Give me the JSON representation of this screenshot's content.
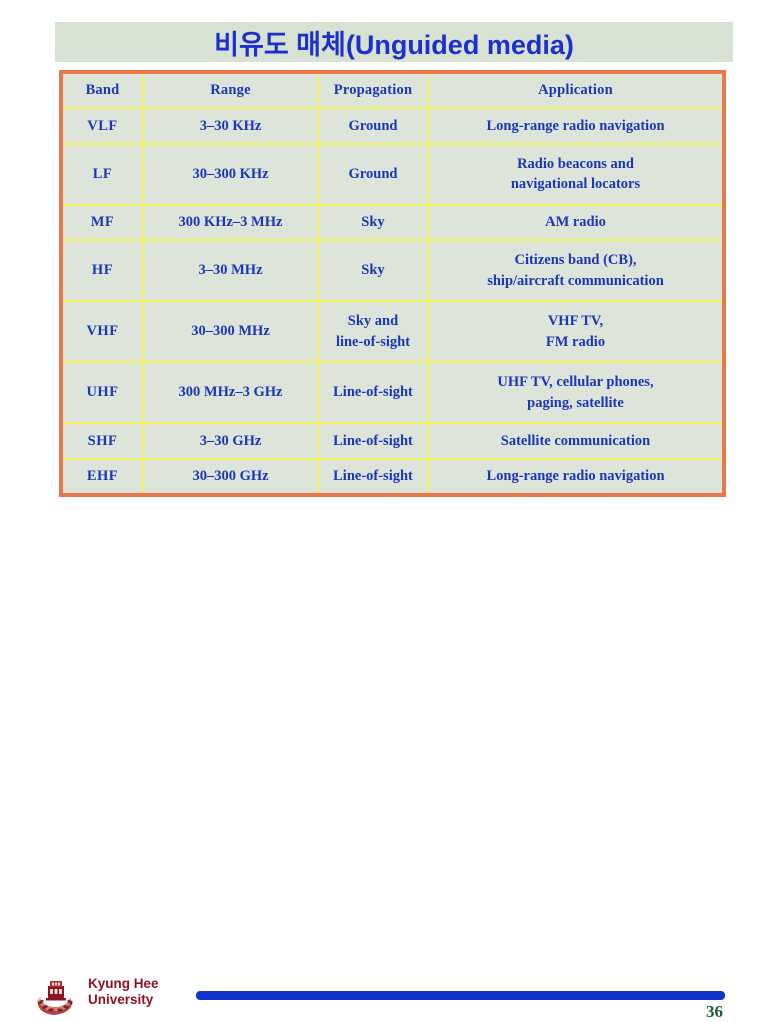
{
  "slide": {
    "title": "비유도 매체(Unguided media)",
    "colors": {
      "title_text": "#1b30cf",
      "title_band_bg": "#d8e2d3",
      "table_border": "#e8784c",
      "grid_line": "#f5f25c",
      "cell_bg": "#dde5da",
      "cell_text": "#1c36b8",
      "band_text": "#e69a7c",
      "footer_bar": "#1134cc",
      "university_text": "#8f1423",
      "page_number_text": "#1f5c33"
    }
  },
  "table": {
    "columns": [
      "Band",
      "Range",
      "Propagation",
      "Application"
    ],
    "rows": [
      {
        "band": "VLF",
        "range": "3–30 KHz",
        "propagation": [
          "Ground"
        ],
        "application": [
          "Long-range radio navigation"
        ]
      },
      {
        "band": "LF",
        "range": "30–300 KHz",
        "propagation": [
          "Ground"
        ],
        "application": [
          "Radio beacons and",
          "navigational locators"
        ]
      },
      {
        "band": "MF",
        "range": "300 KHz–3 MHz",
        "propagation": [
          "Sky"
        ],
        "application": [
          "AM radio"
        ]
      },
      {
        "band": "HF",
        "range": "3–30 MHz",
        "propagation": [
          "Sky"
        ],
        "application": [
          "Citizens band (CB),",
          "ship/aircraft communication"
        ]
      },
      {
        "band": "VHF",
        "range": "30–300 MHz",
        "propagation": [
          "Sky and",
          "line-of-sight"
        ],
        "application": [
          "VHF TV,",
          "FM radio"
        ]
      },
      {
        "band": "UHF",
        "range": "300 MHz–3 GHz",
        "propagation": [
          "Line-of-sight"
        ],
        "application": [
          "UHF TV, cellular phones,",
          "paging, satellite"
        ]
      },
      {
        "band": "SHF",
        "range": "3–30 GHz",
        "propagation": [
          "Line-of-sight"
        ],
        "application": [
          "Satellite communication"
        ]
      },
      {
        "band": "EHF",
        "range": "30–300 GHz",
        "propagation": [
          "Line-of-sight"
        ],
        "application": [
          "Long-range radio navigation"
        ]
      }
    ]
  },
  "footer": {
    "university_line1": "Kyung Hee",
    "university_line2": "University",
    "logo_icon": "kyung-hee-crest-icon",
    "page_number": "36"
  }
}
